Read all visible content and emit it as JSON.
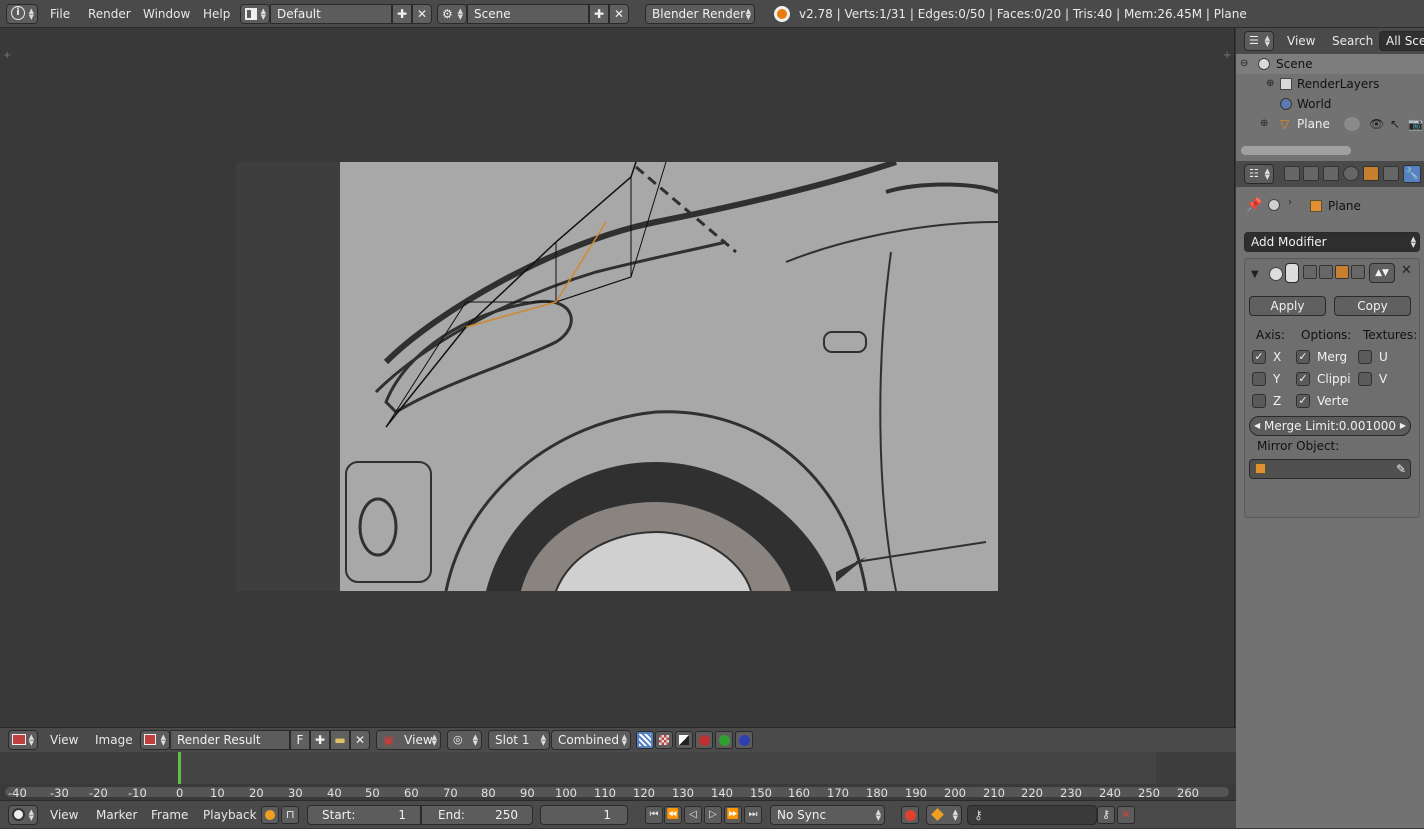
{
  "topbar": {
    "menus": [
      "File",
      "Render",
      "Window",
      "Help"
    ],
    "layout_field": "Default",
    "scene_field": "Scene",
    "engine": "Blender Render",
    "stats": "v2.78 | Verts:1/31 | Edges:0/50 | Faces:0/20 | Tris:40 | Mem:26.45M | Plane"
  },
  "outliner": {
    "menu_view": "View",
    "menu_search": "Search",
    "filter": "All Scen",
    "rows": [
      "Scene",
      "RenderLayers",
      "World",
      "Plane"
    ]
  },
  "properties": {
    "breadcrumb_object": "Plane",
    "add_modifier": "Add Modifier",
    "apply": "Apply",
    "copy": "Copy",
    "axis_label": "Axis:",
    "options_label": "Options:",
    "textures_label": "Textures:",
    "axis": [
      {
        "label": "X",
        "checked": true
      },
      {
        "label": "Y",
        "checked": false
      },
      {
        "label": "Z",
        "checked": false
      }
    ],
    "options": [
      {
        "label": "Merg",
        "checked": true
      },
      {
        "label": "Clippi",
        "checked": true
      },
      {
        "label": "Verte",
        "checked": true
      }
    ],
    "textures": [
      {
        "label": "U",
        "checked": false
      },
      {
        "label": "V",
        "checked": false
      }
    ],
    "merge_limit_label": "Merge Limit:",
    "merge_limit_value": "0.001000",
    "mirror_object_label": "Mirror Object:"
  },
  "image_editor_bar": {
    "view": "View",
    "image": "Image",
    "image_name": "Render Result",
    "fake_user": "F",
    "view_field": "View",
    "slot": "Slot 1",
    "pass": "Combined"
  },
  "timeline": {
    "ticks": [
      "-40",
      "-30",
      "-20",
      "-10",
      "0",
      "10",
      "20",
      "30",
      "40",
      "50",
      "60",
      "70",
      "80",
      "90",
      "100",
      "110",
      "120",
      "130",
      "140",
      "150",
      "160",
      "170",
      "180",
      "190",
      "200",
      "210",
      "220",
      "230",
      "240",
      "250",
      "260"
    ],
    "current_frame_marker": 0
  },
  "timeline_bar": {
    "view": "View",
    "marker": "Marker",
    "frame": "Frame",
    "playback": "Playback",
    "start_label": "Start:",
    "start_value": "1",
    "end_label": "End:",
    "end_value": "250",
    "current_frame": "1",
    "sync": "No Sync"
  },
  "colors": {
    "accent_blue": "#5680c2",
    "timeline_current": "#60c040",
    "record_red": "#e04030",
    "keyframe_orange": "#f0a020"
  }
}
